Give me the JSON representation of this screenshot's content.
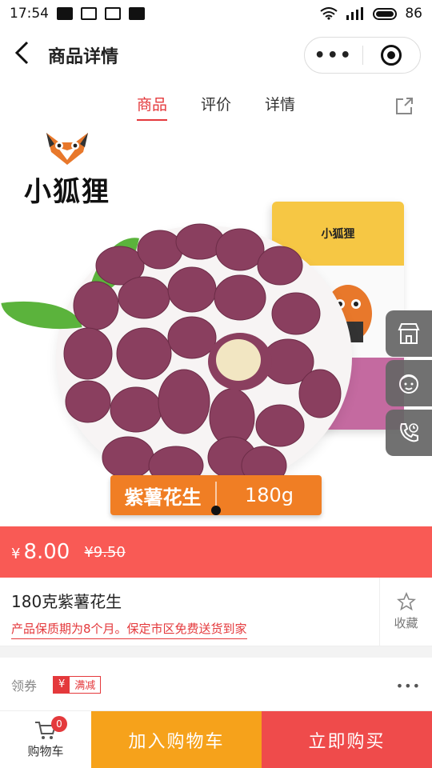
{
  "status_bar": {
    "time": "17:54",
    "battery": "86"
  },
  "nav": {
    "title": "商品详情",
    "more_label": "•••"
  },
  "tabs": [
    {
      "label": "商品",
      "active": true
    },
    {
      "label": "评价",
      "active": false
    },
    {
      "label": "详情",
      "active": false
    }
  ],
  "hero": {
    "brand": "小狐狸",
    "package_brand": "小狐狸",
    "label_name": "紫薯花生",
    "label_weight": "180g"
  },
  "side_buttons": [
    "store-icon",
    "service-icon",
    "phone-icon"
  ],
  "price": {
    "symbol": "¥",
    "current": "8.00",
    "original": "¥9.50"
  },
  "product": {
    "title": "180克紫薯花生",
    "subtitle": "产品保质期为8个月。保定市区免费送货到家",
    "favorite_label": "收藏"
  },
  "coupon": {
    "label": "领券",
    "tag_symbol": "¥",
    "tag_text": "满减",
    "more": "•••"
  },
  "bottom": {
    "cart_label": "购物车",
    "cart_count": "0",
    "add_to_cart": "加入购物车",
    "buy_now": "立即购买"
  },
  "colors": {
    "accent": "#e4393c",
    "price_band": "#f95a55",
    "add_cart": "#f6a21b",
    "buy_now": "#ef4b4b"
  }
}
